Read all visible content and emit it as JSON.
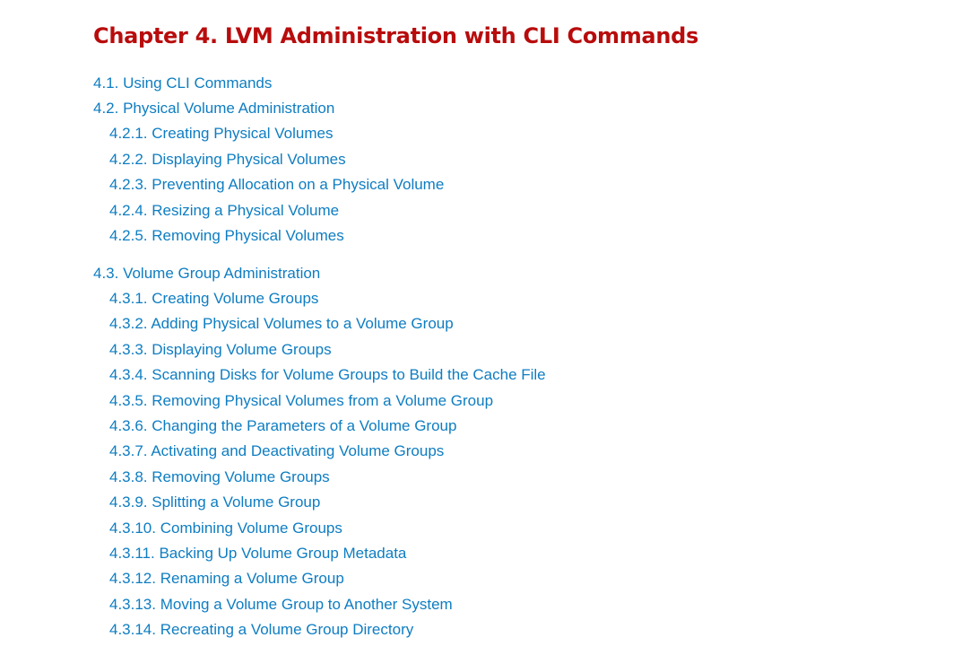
{
  "chapter": {
    "title": "Chapter 4. LVM Administration with CLI Commands"
  },
  "toc": [
    {
      "label": "4.1. Using CLI Commands",
      "level": 1
    },
    {
      "label": "4.2. Physical Volume Administration",
      "level": 1
    },
    {
      "label": "4.2.1. Creating Physical Volumes",
      "level": 2
    },
    {
      "label": "4.2.2. Displaying Physical Volumes",
      "level": 2
    },
    {
      "label": "4.2.3. Preventing Allocation on a Physical Volume",
      "level": 2
    },
    {
      "label": "4.2.4. Resizing a Physical Volume",
      "level": 2
    },
    {
      "label": "4.2.5. Removing Physical Volumes",
      "level": 2
    },
    {
      "label": "4.3. Volume Group Administration",
      "level": 1
    },
    {
      "label": "4.3.1. Creating Volume Groups",
      "level": 2
    },
    {
      "label": "4.3.2. Adding Physical Volumes to a Volume Group",
      "level": 2
    },
    {
      "label": "4.3.3. Displaying Volume Groups",
      "level": 2
    },
    {
      "label": "4.3.4. Scanning Disks for Volume Groups to Build the Cache File",
      "level": 2
    },
    {
      "label": "4.3.5. Removing Physical Volumes from a Volume Group",
      "level": 2
    },
    {
      "label": "4.3.6. Changing the Parameters of a Volume Group",
      "level": 2
    },
    {
      "label": "4.3.7. Activating and Deactivating Volume Groups",
      "level": 2
    },
    {
      "label": "4.3.8. Removing Volume Groups",
      "level": 2
    },
    {
      "label": "4.3.9. Splitting a Volume Group",
      "level": 2
    },
    {
      "label": "4.3.10. Combining Volume Groups",
      "level": 2
    },
    {
      "label": "4.3.11. Backing Up Volume Group Metadata",
      "level": 2
    },
    {
      "label": "4.3.12. Renaming a Volume Group",
      "level": 2
    },
    {
      "label": "4.3.13. Moving a Volume Group to Another System",
      "level": 2
    },
    {
      "label": "4.3.14. Recreating a Volume Group Directory",
      "level": 2
    }
  ],
  "colors": {
    "title": "#b80c0c",
    "link": "#0e7dc2",
    "background": "#ffffff"
  }
}
